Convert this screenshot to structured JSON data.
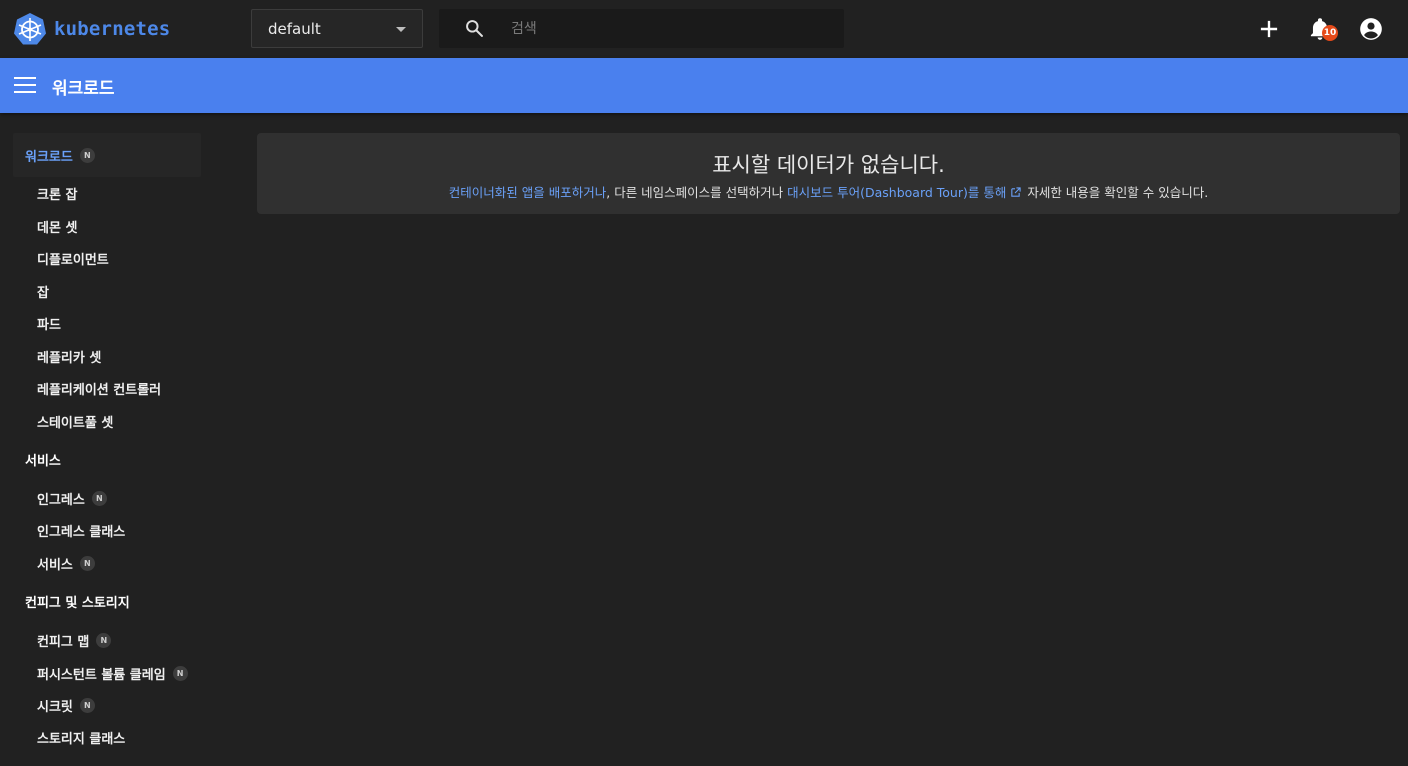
{
  "topbar": {
    "logo_text": "kubernetes",
    "namespace": "default",
    "search_placeholder": "검색",
    "notification_count": "10"
  },
  "header": {
    "title": "워크로드"
  },
  "sidebar": {
    "workloads": {
      "label": "워크로드",
      "badge": "N"
    },
    "workload_items": [
      {
        "label": "크론 잡"
      },
      {
        "label": "데몬 셋"
      },
      {
        "label": "디플로이먼트"
      },
      {
        "label": "잡"
      },
      {
        "label": "파드"
      },
      {
        "label": "레플리카 셋"
      },
      {
        "label": "레플리케이션 컨트롤러"
      },
      {
        "label": "스테이트풀 셋"
      }
    ],
    "services": {
      "label": "서비스"
    },
    "service_items": [
      {
        "label": "인그레스",
        "badge": "N"
      },
      {
        "label": "인그레스 클래스"
      },
      {
        "label": "서비스",
        "badge": "N"
      }
    ],
    "config": {
      "label": "컨피그 및 스토리지"
    },
    "config_items": [
      {
        "label": "컨피그 맵",
        "badge": "N"
      },
      {
        "label": "퍼시스턴트 볼륨 클레임",
        "badge": "N"
      },
      {
        "label": "시크릿",
        "badge": "N"
      },
      {
        "label": "스토리지 클래스"
      }
    ]
  },
  "empty_state": {
    "title": "표시할 데이터가 없습니다.",
    "link_deploy": "컨테이너화된 앱을 배포하거나",
    "text_middle": ", 다른 네임스페이스를 선택하거나 ",
    "link_tour": "대시보드 투어(Dashboard Tour)를 통해",
    "text_end": " 자세한 내용을 확인할 수 있습니다."
  },
  "colors": {
    "accent": "#4a80ee",
    "link": "#6aa0f7",
    "background": "#212121",
    "card": "#303030",
    "badge": "#e64a19"
  },
  "icons": [
    "kubernetes-logo",
    "search-icon",
    "plus-icon",
    "bell-icon",
    "account-circle-icon",
    "menu-icon",
    "open-in-new-icon"
  ]
}
